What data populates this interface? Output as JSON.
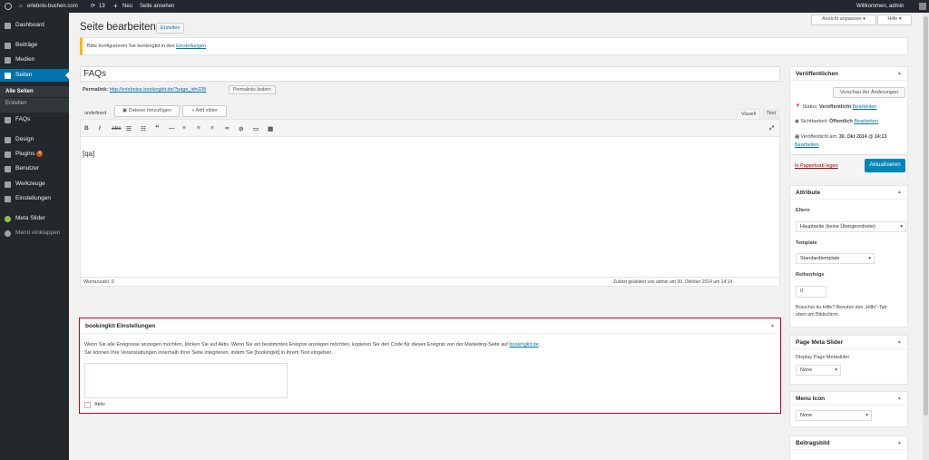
{
  "adminbar": {
    "site_name": "erlebnis-buchen.com",
    "updates": "13",
    "new": "Neu",
    "view_page": "Seite ansehen",
    "welcome": "Willkommen, admin"
  },
  "sidebar": {
    "items": [
      {
        "label": "Dashboard",
        "icon": "dashboard-icon"
      },
      {
        "label": "Beiträge",
        "icon": "pin-icon"
      },
      {
        "label": "Medien",
        "icon": "media-icon"
      },
      {
        "label": "Seiten",
        "icon": "pages-icon"
      },
      {
        "label": "FAQs",
        "icon": "pin-icon"
      },
      {
        "label": "Design",
        "icon": "brush-icon"
      },
      {
        "label": "Plugins",
        "icon": "plugin-icon",
        "badge": "4"
      },
      {
        "label": "Benutzer",
        "icon": "user-icon"
      },
      {
        "label": "Werkzeuge",
        "icon": "wrench-icon"
      },
      {
        "label": "Einstellungen",
        "icon": "settings-icon"
      },
      {
        "label": "Meta Slider",
        "icon": "slider-icon"
      },
      {
        "label": "Menü einklappen",
        "icon": "collapse-icon"
      }
    ],
    "submenu": [
      "Alle Seiten",
      "Erstellen"
    ]
  },
  "screen_options": "Ansicht anpassen",
  "help": "Hilfe",
  "page_title": "Seite bearbeiten",
  "add_new": "Erstellen",
  "notice": {
    "text": "Bitte konfigurieren Sie bookingkit in den",
    "link": "Einstellungen"
  },
  "title_value": "FAQs",
  "permalink": {
    "label": "Permalink:",
    "url": "http://erlebnise.bookingkit.de/?page_id=228",
    "button": "Permalinks ändern"
  },
  "editor": {
    "undefined": "undefined",
    "add_media": "Dateien hinzufügen",
    "add_slider": "Add slider",
    "tab_visual": "Visuell",
    "tab_text": "Text",
    "content": "[qa]",
    "word_count": "Wortanzahl: 0",
    "last_edited": "Zuletzt geändert von admin am 30. Oktober 2014 um 14:14"
  },
  "bookingkit": {
    "title": "bookingkit Einstellungen",
    "line1": "Wenn Sie alle Ereignisse anzeigen möchten, klicken Sie auf Aktiv. Wenn Sie ein bestimmtes Ereignis anzeigen möchten, kopieren Sie den Code für dieses Ereignis von der Marketing-Seite auf",
    "line1_link": "bookingkit.de",
    "line2": "Sie können Ihre Veranstaltungen innerhalb Ihrer Seite integrieren, indem Sie [bookingkit] in Ihrem Text eingeben.",
    "checkbox": "Aktiv"
  },
  "publish": {
    "title": "Veröffentlichen",
    "preview": "Vorschau der Änderungen",
    "status_label": "Status:",
    "status_value": "Veröffentlicht",
    "status_edit": "Bearbeiten",
    "visibility_label": "Sichtbarkeit:",
    "visibility_value": "Öffentlich",
    "visibility_edit": "Bearbeiten",
    "published_label": "Veröffentlicht am:",
    "published_value": "30. Okt 2014 @ 14:13",
    "published_edit": "Bearbeiten",
    "trash": "In Papierkorb legen",
    "update": "Aktualisieren"
  },
  "attributes": {
    "title": "Attribute",
    "parent_label": "Eltern",
    "parent_value": "Hauptseite (keine Übergeordnete)",
    "template_label": "Template",
    "template_value": "Standardtemplate",
    "order_label": "Reihenfolge",
    "order_value": "0",
    "help1": "Brauchst du Hilfe? Benutze den „Hilfe“-Tab",
    "help2": "oben am Bildschirm."
  },
  "metaslider": {
    "title": "Page Meta Slider",
    "label": "Display Page Metaslider",
    "value": "None"
  },
  "menu_icon": {
    "title": "Menu Icon",
    "value": "None"
  },
  "featured": {
    "title": "Beitragsbild"
  },
  "colors": {
    "accent": "#0073aa",
    "highlight_border": "#d0021b",
    "sidebar_bg": "#23282d"
  }
}
